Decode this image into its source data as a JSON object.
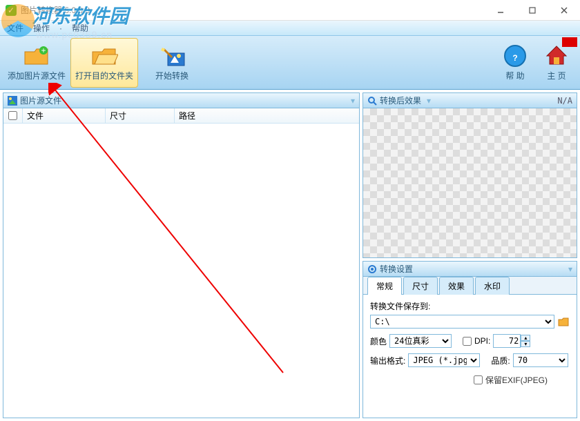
{
  "titlebar": {
    "title": "图片转换器 5.0.0.0"
  },
  "menubar": {
    "file": "文件",
    "action": "操作",
    "help": "帮助",
    "sep": "·"
  },
  "toolbar": {
    "add_source": "添加图片源文件",
    "open_target": "打开目的文件夹",
    "start_convert": "开始转换",
    "help": "帮 助",
    "home": "主 页"
  },
  "left": {
    "header": "图片源文件",
    "col_file": "文件",
    "col_size": "尺寸",
    "col_path": "路径"
  },
  "preview": {
    "header": "转换后效果",
    "na": "N/A"
  },
  "settings": {
    "header": "转换设置",
    "tabs": {
      "general": "常规",
      "size": "尺寸",
      "effect": "效果",
      "watermark": "水印"
    },
    "save_to_label": "转换文件保存到:",
    "save_path": "C:\\",
    "color_label": "颜色",
    "color_value": "24位真彩",
    "dpi_label": "DPI:",
    "dpi_value": "72",
    "format_label": "输出格式:",
    "format_value": "JPEG (*.jpg)",
    "quality_label": "品质:",
    "quality_value": "70",
    "keep_exif": "保留EXIF(JPEG)"
  },
  "watermark_overlay": {
    "brand": "河东软件园",
    "url": "www.pc0359.cn"
  }
}
